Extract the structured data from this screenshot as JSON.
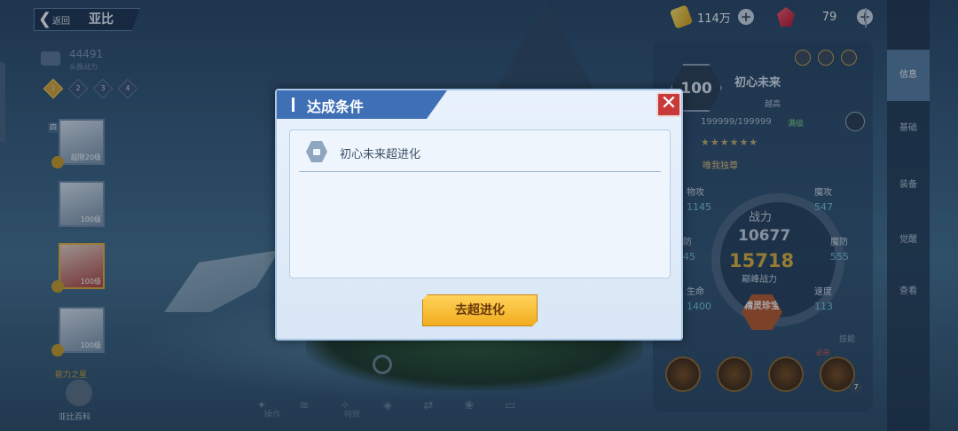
{
  "header": {
    "back_label": "返回",
    "character_name": "亚比"
  },
  "resources": {
    "gold": "114万",
    "gems": "79"
  },
  "left_panel": {
    "power_value": "44491",
    "power_label": "头像战力",
    "stars": [
      "1",
      "2",
      "3",
      "4"
    ],
    "cards": [
      {
        "level": "超限20级",
        "type": "四"
      },
      {
        "level": "100级",
        "type": ""
      },
      {
        "level": "100级",
        "type": ""
      },
      {
        "level": "100级",
        "type": ""
      }
    ],
    "bottom_label": "能力之星",
    "bottom_sub": "亚比百科"
  },
  "right_panel": {
    "level": "100",
    "name": "初心未来",
    "job": "越高",
    "hp": "199999/199999",
    "hp_status": "满级",
    "stars": "★★★★★★",
    "unique": "唯我独尊",
    "power_title": "战力",
    "power_value": "10677",
    "best_power": "15718",
    "best_label": "巅峰战力",
    "badge": "精灵珍宝",
    "stats": [
      {
        "name": "物攻",
        "value": "1145"
      },
      {
        "name": "魔攻",
        "value": "547"
      },
      {
        "name": "防",
        "value": "45"
      },
      {
        "name": "魔防",
        "value": "555"
      },
      {
        "name": "生命",
        "value": "1400"
      },
      {
        "name": "速度",
        "value": "113"
      }
    ],
    "skill_label": "必杀",
    "lock_label": "技能",
    "skill_count": "7",
    "tabs": [
      "信息",
      "基础",
      "装备",
      "觉醒",
      "查看"
    ]
  },
  "toolbar": {
    "label_a": "操作",
    "label_b": "特效"
  },
  "modal": {
    "title": "达成条件",
    "close_symbol": "✕",
    "condition": "初心未来超进化",
    "button": "去超进化"
  },
  "colors": {
    "accent": "#3f6fb5",
    "button": "#f1ac1f",
    "close": "#c83a3a"
  },
  "icons": [
    "back-arrow-icon",
    "gold-coin-icon",
    "gem-icon",
    "plus-icon",
    "lock-icon",
    "close-icon",
    "magnifier-icon"
  ]
}
